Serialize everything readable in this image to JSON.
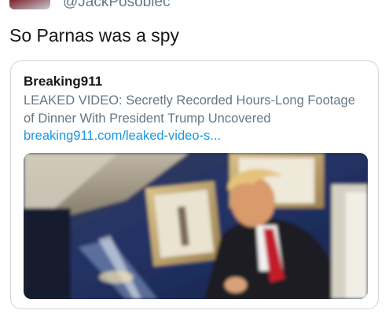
{
  "tweet": {
    "handle": "@JackPosobiec",
    "text": "So Parnas was a spy"
  },
  "card": {
    "site_name": "Breaking911",
    "description": "LEAKED VIDEO: Secretly Recorded Hours-Long Footage of Dinner With President Trump Uncovered",
    "link": "breaking911.com/leaked-video-s..."
  },
  "colors": {
    "link": "#1b95e0",
    "muted": "#657786",
    "text": "#14171a",
    "border": "#ccd6dd"
  }
}
